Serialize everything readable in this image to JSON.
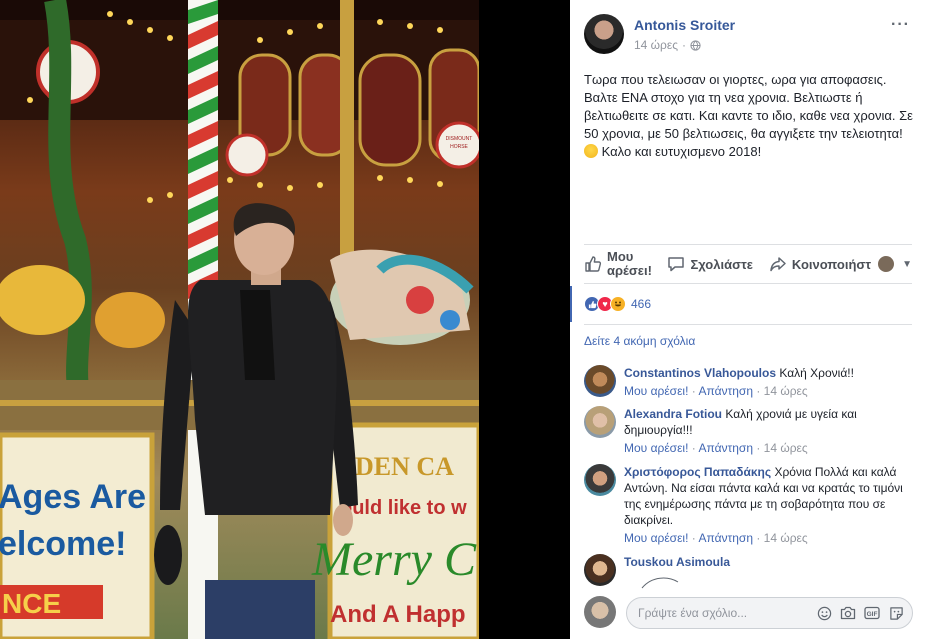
{
  "post": {
    "author": "Antonis Sroiter",
    "time": "14 ώρες",
    "more_options": "···",
    "text": "Τωρα που τελειωσαν οι γιορτες, ωρα για αποφασεις. Βαλτε ΕΝΑ στοχο για τη νεα χρονια. Βελτιωστε ή βελτιωθειτε σε κατι. Και καντε το ιδιο, καθε νεα χρονια. Σε 50 χρονια, με 50 βελτιωσεις, θα αγγιξετε την τελειοτητα!",
    "text_end": " Καλο και ευτυχισμενο 2018!"
  },
  "photo": {
    "signs": [
      "Ages Are",
      "elcome!",
      "NCE",
      "DEN CA",
      "ould like to w",
      "Merry C",
      "And A Happ",
      "DISMOUNT HORSE TO THE LEFT"
    ]
  },
  "actions": {
    "like_line1": "Μου",
    "like_line2": "αρέσει!",
    "comment": "Σχολιάστε",
    "share": "Κοινοποιήστ"
  },
  "reactions": {
    "count": "466",
    "colors": {
      "like": "#4267b2",
      "love": "#f0284a",
      "haha": "#f7b125"
    }
  },
  "more_comments": "Δείτε 4 ακόμη σχόλια",
  "comments": [
    {
      "author": "Constantinos Vlahopoulos",
      "text": "Καλή Χρονιά!!",
      "like": "Μου αρέσει!",
      "reply": "Απάντηση",
      "time": "14 ώρες"
    },
    {
      "author": "Alexandra Fotiou",
      "text": "Καλή χρονιά με υγεία και δημιουργία!!!",
      "like": "Μου αρέσει!",
      "reply": "Απάντηση",
      "time": "14 ώρες"
    },
    {
      "author": "Χριστόφορος Παπαδάκης",
      "text": "Χρόνια Πολλά και καλά Αντώνη. Να είσαι πάντα καλά και να κρατάς το τιμόνι της ενημέρωσης πάντα με τη σοβαρότητα που σε διακρίνει.",
      "like": "Μου αρέσει!",
      "reply": "Απάντηση",
      "time": "14 ώρες"
    },
    {
      "author": "Touskou Asimoula",
      "text": ""
    }
  ],
  "composer": {
    "placeholder": "Γράψτε ένα σχόλιο..."
  },
  "icons": {
    "globe": "globe-icon",
    "like": "thumbs-up-icon",
    "comment": "speech-bubble-icon",
    "share": "share-arrow-icon",
    "emoji": "smiley-icon",
    "camera": "camera-icon",
    "gif": "gif-icon",
    "sticker": "sticker-icon"
  }
}
